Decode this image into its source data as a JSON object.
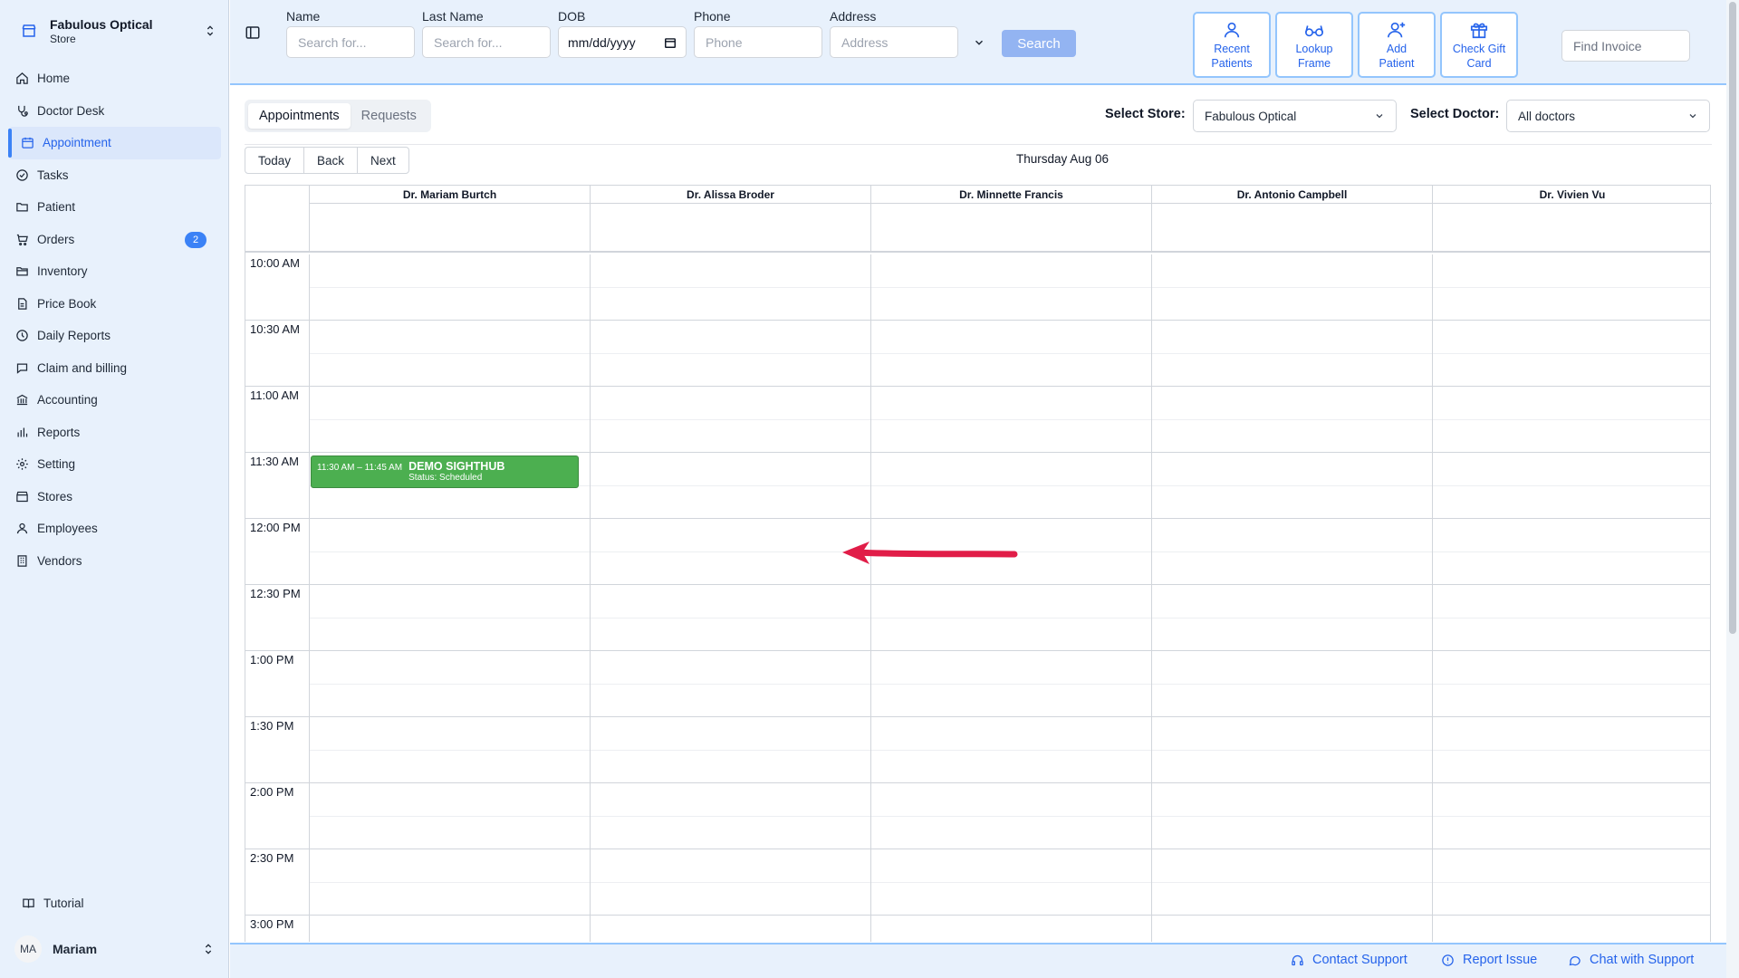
{
  "store": {
    "name": "Fabulous Optical",
    "type": "Store"
  },
  "nav": [
    {
      "label": "Home",
      "icon": "home-icon"
    },
    {
      "label": "Doctor Desk",
      "icon": "stethoscope-icon"
    },
    {
      "label": "Appointment",
      "icon": "calendar-icon",
      "active": true
    },
    {
      "label": "Tasks",
      "icon": "check-circle-icon"
    },
    {
      "label": "Patient",
      "icon": "folder-icon"
    },
    {
      "label": "Orders",
      "icon": "cart-icon",
      "badge": "2"
    },
    {
      "label": "Inventory",
      "icon": "folder-icon"
    },
    {
      "label": "Price Book",
      "icon": "file-icon"
    },
    {
      "label": "Daily Reports",
      "icon": "clock-icon"
    },
    {
      "label": "Claim and billing",
      "icon": "chat-icon"
    },
    {
      "label": "Accounting",
      "icon": "bank-icon"
    },
    {
      "label": "Reports",
      "icon": "bar-chart-icon"
    },
    {
      "label": "Setting",
      "icon": "gear-icon"
    },
    {
      "label": "Stores",
      "icon": "store-icon"
    },
    {
      "label": "Employees",
      "icon": "user-icon"
    },
    {
      "label": "Vendors",
      "icon": "building-icon"
    }
  ],
  "tutorial": "Tutorial",
  "user": {
    "initials": "MA",
    "name": "Mariam"
  },
  "search": {
    "name_label": "Name",
    "name_placeholder": "Search for...",
    "lastname_label": "Last Name",
    "lastname_placeholder": "Search for...",
    "dob_label": "DOB",
    "dob_value": "mm/dd/yyyy",
    "phone_label": "Phone",
    "phone_placeholder": "Phone",
    "address_label": "Address",
    "address_placeholder": "Address",
    "button": "Search"
  },
  "quick_actions": [
    {
      "label1": "Recent",
      "label2": "Patients",
      "icon": "user-icon"
    },
    {
      "label1": "Lookup",
      "label2": "Frame",
      "icon": "glasses-icon"
    },
    {
      "label1": "Add",
      "label2": "Patient",
      "icon": "user-plus-icon"
    },
    {
      "label1": "Check Gift",
      "label2": "Card",
      "icon": "gift-icon"
    }
  ],
  "find_invoice_placeholder": "Find Invoice",
  "tabs": [
    "Appointments",
    "Requests"
  ],
  "select_store": {
    "label": "Select Store:",
    "value": "Fabulous Optical"
  },
  "select_doctor": {
    "label": "Select Doctor:",
    "value": "All doctors"
  },
  "calendar_nav": [
    "Today",
    "Back",
    "Next"
  ],
  "date": "Thursday Aug 06",
  "doctors": [
    "Dr. Mariam Burtch",
    "Dr. Alissa Broder",
    "Dr. Minnette Francis",
    "Dr. Antonio Campbell",
    "Dr. Vivien Vu"
  ],
  "time_slots": [
    "10:00 AM",
    "10:30 AM",
    "11:00 AM",
    "11:30 AM",
    "12:00 PM",
    "12:30 PM",
    "1:00 PM",
    "1:30 PM",
    "2:00 PM",
    "2:30 PM",
    "3:00 PM"
  ],
  "event": {
    "time": "11:30 AM – 11:45 AM",
    "title": "DEMO SIGHTHUB",
    "status": "Status: Scheduled",
    "color": "#4caf50"
  },
  "annotation_arrow_color": "#e11d48",
  "footer": [
    "Contact Support",
    "Report Issue",
    "Chat with Support"
  ],
  "colors": {
    "accent": "#2563eb",
    "sidebar_bg": "#e8f1fc",
    "badge": "#3b82f6"
  }
}
